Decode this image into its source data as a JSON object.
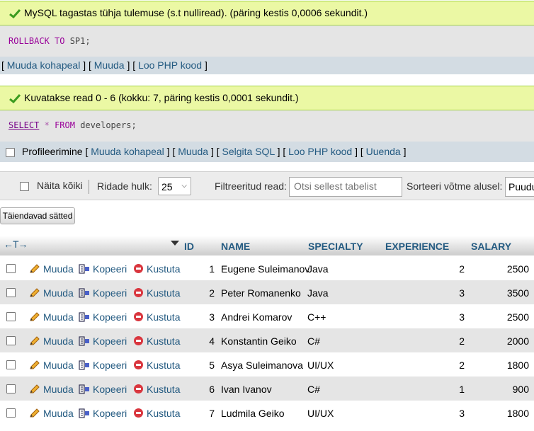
{
  "msg1": {
    "text": "MySQL tagastas tühja tulemuse (s.t nulliread). (päring kestis 0,0006 sekundit.)"
  },
  "sql1": {
    "kw": "ROLLBACK TO",
    "rest": " SP1;"
  },
  "links1": {
    "edit_inline": "Muuda kohapeal",
    "edit": "Muuda",
    "php": "Loo PHP kood"
  },
  "msg2": {
    "text": "Kuvatakse read 0 - 6 (kokku: 7, päring kestis 0,0001 sekundit.)"
  },
  "sql2": {
    "select": "SELECT",
    "star": "*",
    "from": "FROM",
    "rest": " developers;"
  },
  "links2": {
    "profiling": "Profileerimine",
    "edit_inline": "Muuda kohapeal",
    "edit": "Muuda",
    "explain": "Selgita SQL",
    "php": "Loo PHP kood",
    "refresh": "Uuenda"
  },
  "toolbar": {
    "show_all": "Näita kõiki",
    "rows_label": "Ridade hulk:",
    "rows_value": "25",
    "filter_label": "Filtreeritud read:",
    "filter_placeholder": "Otsi sellest tabelist",
    "sort_label": "Sorteeri võtme alusel:",
    "sort_value": "Puudub"
  },
  "extra_options": "Täiendavad sätted",
  "columns": {
    "id": "ID",
    "name": "NAME",
    "specialty": "SPECIALTY",
    "experience": "EXPERIENCE",
    "salary": "SALARY"
  },
  "actions": {
    "edit": "Muuda",
    "copy": "Kopeeri",
    "delete": "Kustuta"
  },
  "rows": [
    {
      "id": "1",
      "name": "Eugene Suleimanov",
      "specialty": "Java",
      "experience": "2",
      "salary": "2500"
    },
    {
      "id": "2",
      "name": "Peter Romanenko",
      "specialty": "Java",
      "experience": "3",
      "salary": "3500"
    },
    {
      "id": "3",
      "name": "Andrei Komarov",
      "specialty": "C++",
      "experience": "3",
      "salary": "2500"
    },
    {
      "id": "4",
      "name": "Konstantin Geiko",
      "specialty": "C#",
      "experience": "2",
      "salary": "2000"
    },
    {
      "id": "5",
      "name": "Asya Suleimanova",
      "specialty": "UI/UX",
      "experience": "2",
      "salary": "1800"
    },
    {
      "id": "6",
      "name": "Ivan Ivanov",
      "specialty": "C#",
      "experience": "1",
      "salary": "900"
    },
    {
      "id": "7",
      "name": "Ludmila Geiko",
      "specialty": "UI/UX",
      "experience": "3",
      "salary": "1800"
    }
  ]
}
